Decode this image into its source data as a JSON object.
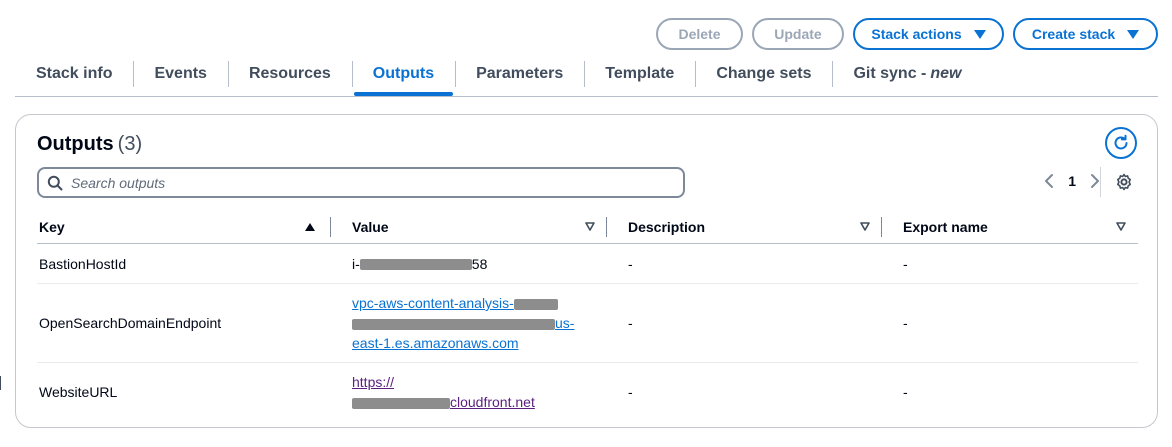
{
  "actions": {
    "delete_label": "Delete",
    "update_label": "Update",
    "stack_actions_label": "Stack actions",
    "create_stack_label": "Create stack"
  },
  "tabs": [
    {
      "label": "Stack info"
    },
    {
      "label": "Events"
    },
    {
      "label": "Resources"
    },
    {
      "label": "Outputs",
      "active": true
    },
    {
      "label": "Parameters"
    },
    {
      "label": "Template"
    },
    {
      "label": "Change sets"
    },
    {
      "label": "Git sync -",
      "suffix": "new"
    }
  ],
  "panel": {
    "title": "Outputs",
    "count": "(3)",
    "search_placeholder": "Search outputs",
    "page": "1"
  },
  "table": {
    "headers": {
      "key": "Key",
      "value": "Value",
      "description": "Description",
      "export_name": "Export name"
    },
    "rows": [
      {
        "key": "BastionHostId",
        "value_prefix": "i-",
        "value_suffix": "58",
        "description": "-",
        "export_name": "-"
      },
      {
        "key": "OpenSearchDomainEndpoint",
        "value_line1": "vpc-aws-content-analysis-",
        "value_line2_suffix": "us-",
        "value_line3": "east-1.es.amazonaws.com",
        "description": "-",
        "export_name": "-"
      },
      {
        "key": "WebsiteURL",
        "value_line1": "https://",
        "value_line2_suffix": "cloudfront.net",
        "description": "-",
        "export_name": "-"
      }
    ]
  },
  "colors": {
    "accent": "#0972d3",
    "disabled": "#9ba7b6",
    "visited_link": "#5a1f80",
    "text": "#000716"
  }
}
